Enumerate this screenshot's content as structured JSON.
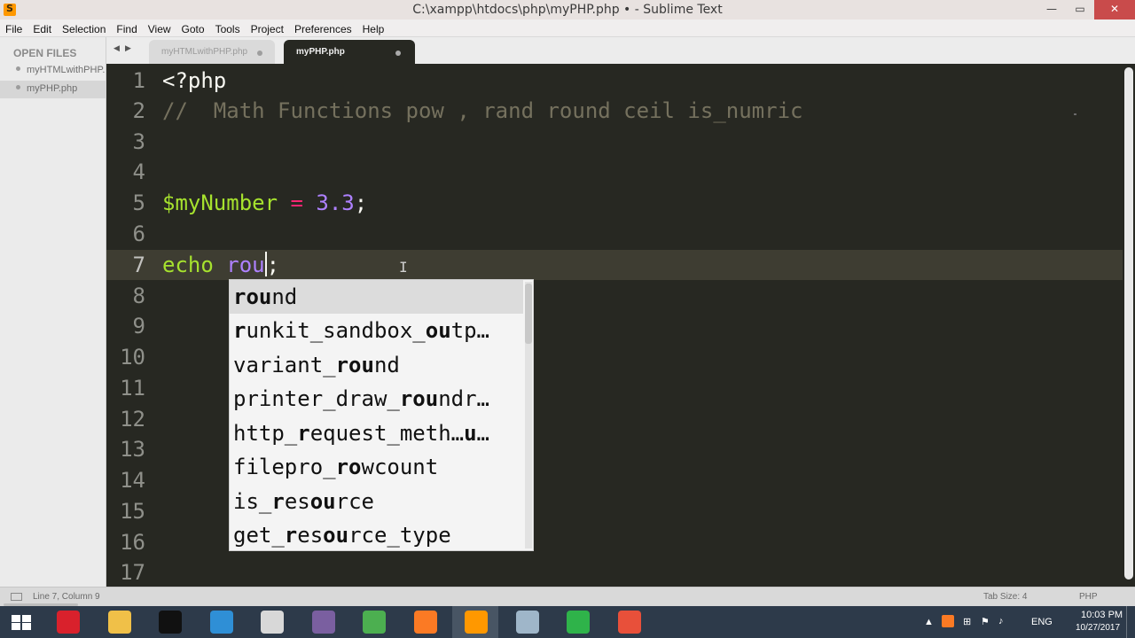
{
  "window": {
    "title": "C:\\xampp\\htdocs\\php\\myPHP.php • - Sublime Text",
    "minimize": "—",
    "maximize": "▭",
    "close": "✕"
  },
  "menu": [
    "File",
    "Edit",
    "Selection",
    "Find",
    "View",
    "Goto",
    "Tools",
    "Project",
    "Preferences",
    "Help"
  ],
  "sidebar": {
    "header": "OPEN FILES",
    "files": [
      {
        "label": "myHTMLwithPHP.php",
        "active": false
      },
      {
        "label": "myPHP.php",
        "active": true
      }
    ]
  },
  "tabs": [
    {
      "label": "myHTMLwithPHP.php",
      "active": false
    },
    {
      "label": "myPHP.php",
      "active": true
    }
  ],
  "editor": {
    "current_line": 7,
    "line_numbers": [
      "1",
      "2",
      "3",
      "4",
      "5",
      "6",
      "7",
      "8",
      "9",
      "10",
      "11",
      "12",
      "13",
      "14",
      "15",
      "16",
      "17"
    ],
    "lines": {
      "l1": "<?php",
      "l2": "//  Math Functions pow , rand round ceil is_numric",
      "l5_var": "$myNumber",
      "l5_op": " = ",
      "l5_num": "3.3",
      "l5_end": ";",
      "l7_kw": "echo",
      "l7_typed": "rou",
      "l7_end": ";"
    }
  },
  "autocomplete": {
    "items": [
      {
        "pre": "",
        "bold": "rou",
        "post": "nd"
      },
      {
        "pre": "",
        "bold": "r",
        "post": "unkit_sandbox_",
        "bold2": "ou",
        "post2": "tp…"
      },
      {
        "pre": "variant_",
        "bold": "rou",
        "post": "nd"
      },
      {
        "pre": "printer_draw_",
        "bold": "rou",
        "post": "ndr…"
      },
      {
        "pre": "http_",
        "bold": "r",
        "post": "equest_meth…",
        "bold2": "u",
        "post2": "…"
      },
      {
        "pre": "filepro_",
        "bold": "ro",
        "post": "wcount"
      },
      {
        "pre": "is_",
        "bold": "r",
        "post": "es",
        "bold2": "ou",
        "post2": "rce"
      },
      {
        "pre": "get_",
        "bold": "r",
        "post": "es",
        "bold2": "ou",
        "post2": "rce_type"
      }
    ]
  },
  "status": {
    "position": "Line 7, Column 9",
    "tab_size": "Tab Size: 4",
    "syntax": "PHP"
  },
  "taskbar": {
    "apps": [
      {
        "name": "opera-icon",
        "color": "#d9212c",
        "active": false
      },
      {
        "name": "file-explorer-icon",
        "color": "#f0c048",
        "active": false
      },
      {
        "name": "light-bulb-app-icon",
        "color": "#111111",
        "active": false
      },
      {
        "name": "notepad-app-icon",
        "color": "#2f8fd6",
        "active": false
      },
      {
        "name": "paint-app-icon",
        "color": "#d8d8d8",
        "active": false
      },
      {
        "name": "winrar-icon",
        "color": "#7a5fa0",
        "active": false
      },
      {
        "name": "chrome-icon",
        "color": "#4caf50",
        "active": false
      },
      {
        "name": "xampp-icon",
        "color": "#fb7a24",
        "active": false
      },
      {
        "name": "sublime-text-icon",
        "color": "#ff9800",
        "active": true
      },
      {
        "name": "remote-desktop-icon",
        "color": "#9fb6c9",
        "active": false
      },
      {
        "name": "camtasia-green-icon",
        "color": "#2fb34a",
        "active": false
      },
      {
        "name": "camtasia-red-icon",
        "color": "#e8503a",
        "active": false
      }
    ],
    "language": "ENG",
    "time": "10:03 PM",
    "date": "10/27/2017"
  }
}
